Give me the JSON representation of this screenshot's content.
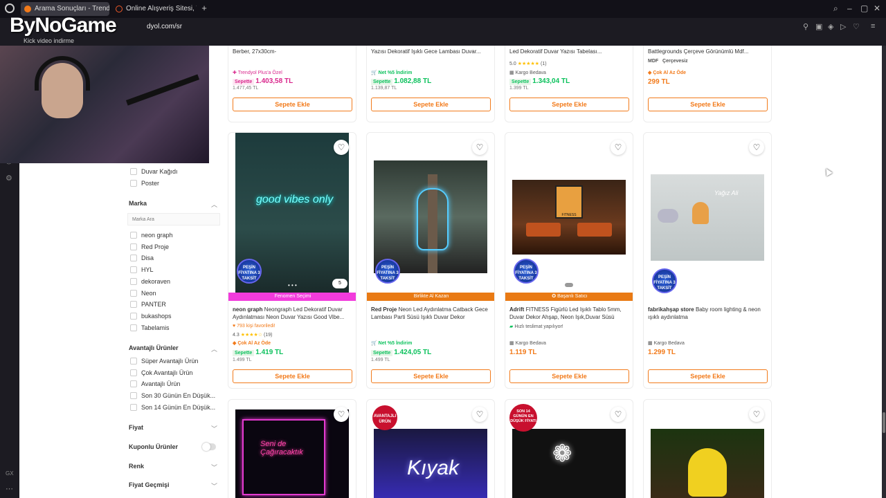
{
  "browser": {
    "tabs": [
      {
        "label": "Arama Sonuçları - Trendyol"
      },
      {
        "label": "Online Alışveriş Sitesi, Türk"
      }
    ],
    "url_prefix": "dyol.com/sr",
    "bookmark": "Kick video indirme"
  },
  "overlay": {
    "logo_text": "ByNoGame"
  },
  "filters": {
    "top_items": [
      "Berber, 27x30cm-"
    ],
    "category_items": [
      "Duvar Kağıdı",
      "Poster"
    ],
    "marka": {
      "title": "Marka",
      "search_placeholder": "Marka Ara",
      "items": [
        "neon graph",
        "Red Proje",
        "Disa",
        "HYL",
        "dekoraven",
        "Neon",
        "PANTER",
        "bukashops",
        "Tabelamis"
      ]
    },
    "avantajli": {
      "title": "Avantajlı Ürünler",
      "items": [
        "Süper Avantajlı Ürün",
        "Çok Avantajlı Ürün",
        "Avantajlı Ürün",
        "Son 30 Günün En Düşük...",
        "Son 14 Günün En Düşük..."
      ]
    },
    "fiyat": "Fiyat",
    "kuponlu": "Kuponlu Ürünler",
    "renk": "Renk",
    "fiyat_gecmisi": "Fiyat Geçmişi"
  },
  "row1": [
    {
      "title": "Berber, 27x30cm-",
      "tag": "Trendyol Plus'a Özel",
      "sepete_label": "Sepette",
      "sepete": "1.403,58 TL",
      "old": "1.477,45 TL",
      "button": "Sepete Ekle"
    },
    {
      "title": "Yazısı Dekoratif Işıklı Gece Lambası Duvar...",
      "tag": "Net %5 İndirim",
      "sepete_label": "Sepette",
      "sepete": "1.082,88 TL",
      "old": "1.139,87 TL",
      "button": "Sepete Ekle"
    },
    {
      "title": "Led Dekoratif Duvar Yazısı Tabelası...",
      "rating": "5.0",
      "reviews": "(1)",
      "tag": "Kargo Bedava",
      "sepete_label": "Sepette",
      "sepete": "1.343,04 TL",
      "old": "1.399 TL",
      "button": "Sepete Ekle"
    },
    {
      "title": "Battlegrounds Çerçeve Görünümlü Mdf...",
      "chips": [
        "MDF",
        "Çerçevesiz"
      ],
      "tag": "Çok Al Az Öde",
      "price": "299 TL",
      "button": "Sepete Ekle"
    }
  ],
  "row2": [
    {
      "banner": "Fenomen Seçimi",
      "brand": "neon graph",
      "title": "Neongraph Led Dekoratif Duvar Aydınlatması Neon Duvar Yazısı Good Vibe...",
      "fav": "793 kişi favoriledi!",
      "rating": "4.3",
      "reviews": "(19)",
      "tag": "Çok Al Az Öde",
      "sepete_label": "Sepette",
      "sepete": "1.419 TL",
      "old": "1.499 TL",
      "button": "Sepete Ekle",
      "image_text": "good vibes only",
      "photo_count": "5",
      "badge": "PEŞİN FİYATINA 3 TAKSİT"
    },
    {
      "banner": "Birlikte Al Kazan",
      "brand": "Red Proje",
      "title": "Neon Led Aydınlatma Catback Gece Lambası Parti Süsü Işıklı Duvar Dekor",
      "tag": "Net %5 İndirim",
      "sepete_label": "Sepette",
      "sepete": "1.424,05 TL",
      "old": "1.499 TL",
      "button": "Sepete Ekle",
      "badge": "PEŞİN FİYATINA 3 TAKSİT"
    },
    {
      "banner": "Başarılı Satıcı",
      "brand": "Adrift",
      "title": "FITNESS Figürlü Led Işıklı Tablo 5mm, Duvar Dekor Ahşap, Neon Işık,Duvar Süsü",
      "delivery": "Hızlı teslimat yapılıyor!",
      "tag": "Kargo Bedava",
      "price": "1.119 TL",
      "button": "Sepete Ekle",
      "image_text": "FITNESS",
      "badge": "PEŞİN FİYATINA 3 TAKSİT"
    },
    {
      "brand": "fabrikahşap store",
      "title": "Baby room lighting & neon ışıklı aydınlatma",
      "tag": "Kargo Bedava",
      "price": "1.299 TL",
      "button": "Sepete Ekle",
      "image_text": "Yağız Ali",
      "badge": "PEŞİN FİYATINA 3 TAKSİT"
    }
  ],
  "row3": [
    {
      "image_text": "Seni de Çağıracaktık"
    },
    {
      "image_text": "Kıyak",
      "badge": "AVANTAJLI ÜRÜN"
    },
    {
      "badge": "SON 14 GÜNÜN EN DÜŞÜK FİYATI"
    },
    {}
  ],
  "colors": {
    "accent": "#f27a1a",
    "green": "#0bc15c"
  }
}
